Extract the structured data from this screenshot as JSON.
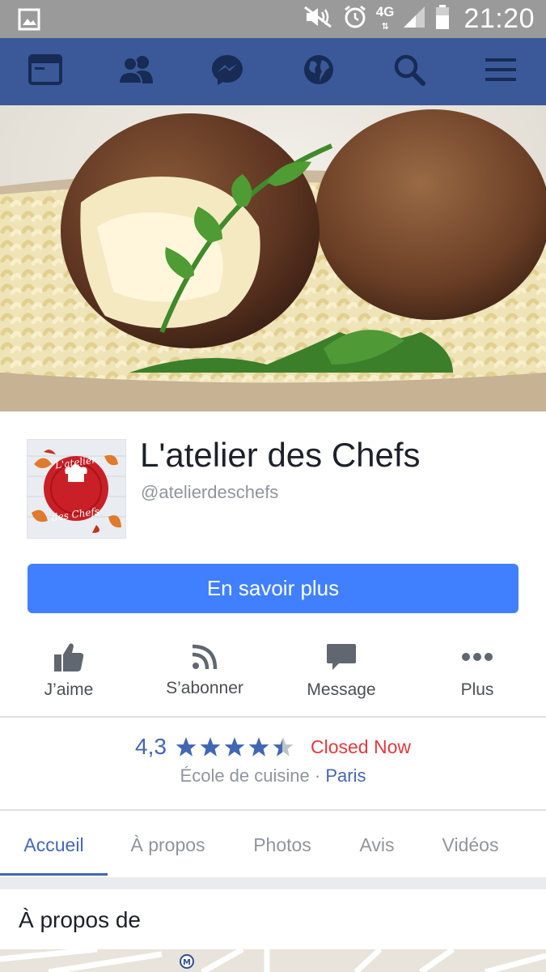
{
  "status_bar": {
    "time": "21:20",
    "network": "4G",
    "icons": [
      "image-icon",
      "mute-icon",
      "alarm-icon",
      "signal-icon",
      "battery-icon"
    ]
  },
  "nav": {
    "icons": [
      "news-feed-icon",
      "friends-icon",
      "messenger-icon",
      "globe-icon",
      "search-icon",
      "menu-icon"
    ],
    "color": "#3b5998"
  },
  "cover": {
    "description_icon": "cover-photo-icon"
  },
  "page": {
    "name": "L'atelier des Chefs",
    "handle": "@atelierdeschefs",
    "logo_text_top": "L'atelier",
    "logo_text_bottom": "des Chefs"
  },
  "cta": {
    "label": "En savoir plus",
    "color": "#4080ff"
  },
  "actions": [
    {
      "label": "J’aime",
      "icon": "like-icon"
    },
    {
      "label": "S’abonner",
      "icon": "follow-rss-icon"
    },
    {
      "label": "Message",
      "icon": "message-icon"
    },
    {
      "label": "Plus",
      "icon": "more-icon"
    }
  ],
  "info": {
    "rating": "4,3",
    "rating_value": 4.3,
    "status": "Closed Now",
    "category": "École de cuisine",
    "separator": "·",
    "city": "Paris"
  },
  "tabs": [
    {
      "label": "Accueil",
      "active": true
    },
    {
      "label": "À propos",
      "active": false
    },
    {
      "label": "Photos",
      "active": false
    },
    {
      "label": "Avis",
      "active": false
    },
    {
      "label": "Vidéos",
      "active": false
    }
  ],
  "about": {
    "title": "À propos de"
  }
}
